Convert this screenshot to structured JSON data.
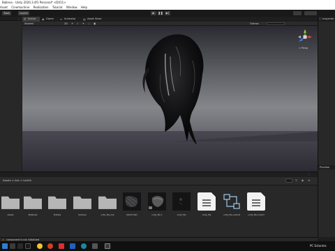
{
  "window": {
    "title": "Ballena - Unity 2020.3.4f1 Personal* <DX11>"
  },
  "menu": [
    "Asset",
    "Cinemachine",
    "Realization",
    "Tutorial",
    "Window",
    "Help"
  ],
  "toolbar": {
    "account_label": "Tools",
    "cloud_label": "Layers",
    "play_icons": [
      "play-icon",
      "pause-icon",
      "step-icon"
    ]
  },
  "scene_tabs": [
    {
      "label": "Scene",
      "icon": "scene-icon",
      "active": true
    },
    {
      "label": "Game",
      "icon": "game-icon",
      "active": false
    },
    {
      "label": "Animator",
      "icon": "animator-icon",
      "active": false
    },
    {
      "label": "Asset Store",
      "icon": "store-icon",
      "active": false
    }
  ],
  "scene_toolbar": {
    "shading_mode": "Shaded",
    "view_2d": "2D",
    "gizmos_label": "Gizmos"
  },
  "viewport": {
    "orientation_label": "< Persp"
  },
  "inspector": {
    "tab_label": "Inspector"
  },
  "preview": {
    "tab_label": "Preview"
  },
  "project": {
    "breadcrumb": "Assets > hair > hair04",
    "assets": [
      {
        "name": "Assets",
        "kind": "folder"
      },
      {
        "name": "Materials",
        "kind": "folder"
      },
      {
        "name": "Prefabs",
        "kind": "folder"
      },
      {
        "name": "textures",
        "kind": "folder"
      },
      {
        "name": "unity_file_hair",
        "kind": "folder"
      },
      {
        "name": "hair04 Hairi",
        "kind": "texture"
      },
      {
        "name": "unity_file 1",
        "kind": "model"
      },
      {
        "name": "unity_file",
        "kind": "texture-dark"
      },
      {
        "name": "unity_file",
        "kind": "document"
      },
      {
        "name": "unity_file_animat",
        "kind": "hierarchy"
      },
      {
        "name": "unity_file_Import",
        "kind": "document"
      }
    ]
  },
  "status_bar": {
    "message": "component is not initialized"
  },
  "taskbar": {
    "tray_text": "PC  Estantes"
  },
  "colors": {
    "accent_gizmo_x": "#e0453a",
    "accent_gizmo_y": "#8cc63f",
    "accent_gizmo_z": "#3a7be0",
    "warning": "#e0b020"
  }
}
